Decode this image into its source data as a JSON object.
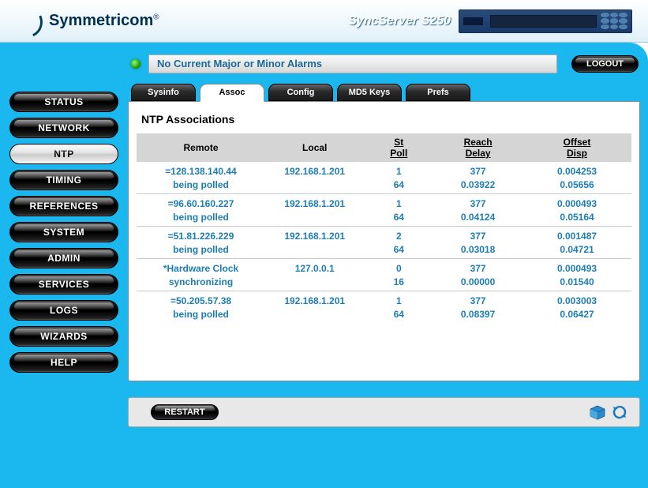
{
  "header": {
    "brand": "Symmetricom",
    "product": "SyncServer S250"
  },
  "sidebar": {
    "items": [
      {
        "label": "STATUS",
        "active": false
      },
      {
        "label": "NETWORK",
        "active": false
      },
      {
        "label": "NTP",
        "active": true
      },
      {
        "label": "TIMING",
        "active": false
      },
      {
        "label": "REFERENCES",
        "active": false
      },
      {
        "label": "SYSTEM",
        "active": false
      },
      {
        "label": "ADMIN",
        "active": false
      },
      {
        "label": "SERVICES",
        "active": false
      },
      {
        "label": "LOGS",
        "active": false
      },
      {
        "label": "WIZARDS",
        "active": false
      },
      {
        "label": "HELP",
        "active": false
      }
    ]
  },
  "status_bar": {
    "alarm_text": "No Current Major or Minor Alarms",
    "logout_label": "LOGOUT"
  },
  "tabs": [
    {
      "label": "Sysinfo",
      "active": false
    },
    {
      "label": "Assoc",
      "active": true
    },
    {
      "label": "Config",
      "active": false
    },
    {
      "label": "MD5 Keys",
      "active": false
    },
    {
      "label": "Prefs",
      "active": false
    }
  ],
  "panel": {
    "title": "NTP Associations",
    "headers": {
      "remote": "Remote",
      "local": "Local",
      "st": "St",
      "poll": "Poll",
      "reach": "Reach",
      "delay": "Delay",
      "offset": "Offset",
      "disp": "Disp"
    },
    "rows": [
      {
        "remote": "=128.138.140.44",
        "status": "being polled",
        "local": "192.168.1.201",
        "st": "1",
        "poll": "64",
        "reach": "377",
        "delay": "0.03922",
        "offset": "0.004253",
        "disp": "0.05656"
      },
      {
        "remote": "=96.60.160.227",
        "status": "being polled",
        "local": "192.168.1.201",
        "st": "1",
        "poll": "64",
        "reach": "377",
        "delay": "0.04124",
        "offset": "0.000493",
        "disp": "0.05164"
      },
      {
        "remote": "=51.81.226.229",
        "status": "being polled",
        "local": "192.168.1.201",
        "st": "2",
        "poll": "64",
        "reach": "377",
        "delay": "0.03018",
        "offset": "0.001487",
        "disp": "0.04721"
      },
      {
        "remote": "*Hardware Clock",
        "status": "synchronizing",
        "local": "127.0.0.1",
        "st": "0",
        "poll": "16",
        "reach": "377",
        "delay": "0.00000",
        "offset": "0.000493",
        "disp": "0.01540"
      },
      {
        "remote": "=50.205.57.38",
        "status": "being polled",
        "local": "192.168.1.201",
        "st": "1",
        "poll": "64",
        "reach": "377",
        "delay": "0.08397",
        "offset": "0.003003",
        "disp": "0.06427"
      }
    ]
  },
  "footer": {
    "restart_label": "RESTART"
  }
}
